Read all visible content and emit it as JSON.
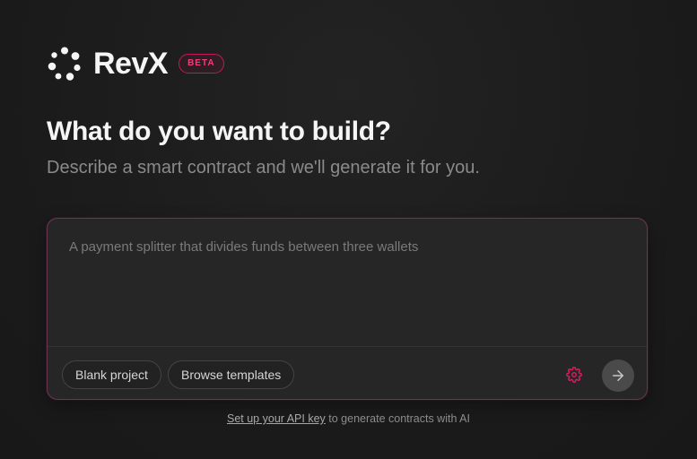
{
  "brand": {
    "name": "RevX",
    "badge": "BETA",
    "logo_icon": "dotted-ring-logo",
    "accent_color": "#ec407a"
  },
  "hero": {
    "title": "What do you want to build?",
    "subtitle": "Describe a smart contract and we'll generate it for you."
  },
  "prompt": {
    "value": "",
    "placeholder": "A payment splitter that divides funds between three wallets"
  },
  "actions": {
    "blank_project_label": "Blank project",
    "browse_templates_label": "Browse templates",
    "settings_icon": "gear-icon",
    "submit_icon": "arrow-right-icon"
  },
  "footer": {
    "link_text": "Set up your API key",
    "rest_text": " to generate contracts with AI"
  }
}
